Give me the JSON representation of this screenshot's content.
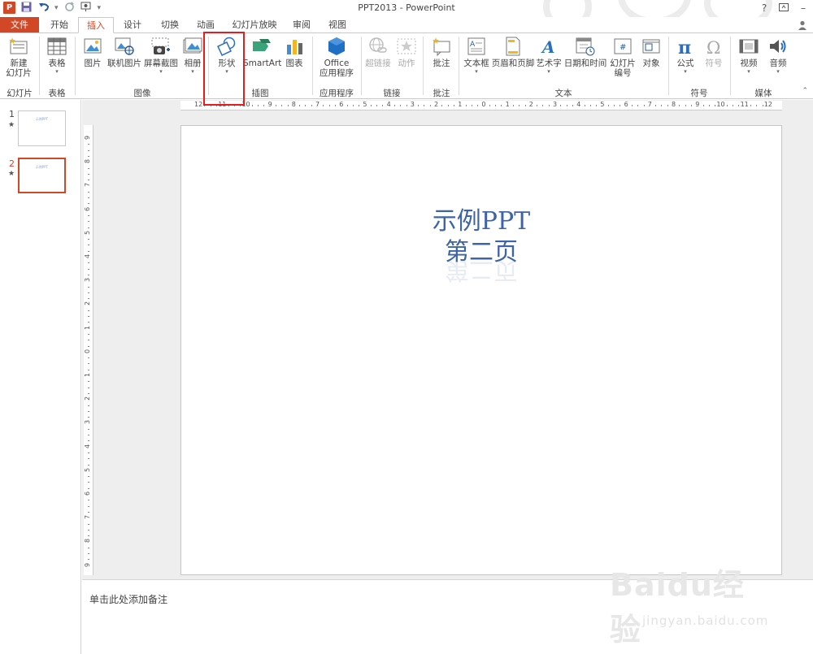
{
  "app": {
    "window_title": "PPT2013 - PowerPoint",
    "logo_letter": "P",
    "help": "?",
    "accent": "#d24726"
  },
  "quick_access": {
    "save_icon": "save-icon",
    "undo_icon": "undo-icon",
    "redo_icon": "redo-icon",
    "start_icon": "slideshow-from-start-icon",
    "customize_icon": "customize-qat-icon"
  },
  "tabs": [
    "文件",
    "开始",
    "插入",
    "设计",
    "切换",
    "动画",
    "幻灯片放映",
    "审阅",
    "视图"
  ],
  "active_tab": "插入",
  "ribbon": {
    "buttons": {
      "new_slide": "新建\n幻灯片",
      "table": "表格",
      "picture": "图片",
      "online_picture": "联机图片",
      "screenshot": "屏幕截图",
      "album": "相册",
      "shapes": "形状",
      "smartart": "SmartArt",
      "chart": "图表",
      "office_apps": "Office\n应用程序",
      "hyperlink": "超链接",
      "action": "动作",
      "comment": "批注",
      "textbox": "文本框",
      "header_footer": "页眉和页脚",
      "wordart": "艺术字",
      "date_time": "日期和时间",
      "slide_number": "幻灯片\n编号",
      "object": "对象",
      "equation": "公式",
      "symbol": "符号",
      "video": "视频",
      "audio": "音频"
    },
    "groups": {
      "slides": "幻灯片",
      "tables": "表格",
      "images": "图像",
      "illustrations": "插图",
      "apps": "应用程序",
      "links": "链接",
      "comments": "批注",
      "text": "文本",
      "symbols": "符号",
      "media": "媒体"
    }
  },
  "thumbnails": [
    {
      "number": "1",
      "star": "★",
      "text": "示例PPT"
    },
    {
      "number": "2",
      "star": "★",
      "text": "示例PPT"
    }
  ],
  "slide": {
    "line1": "示例PPT",
    "line2": "第二页",
    "text_color": "#3e64a8"
  },
  "ruler": {
    "h_labels": [
      "12",
      "11",
      "10",
      "9",
      "8",
      "7",
      "6",
      "5",
      "4",
      "3",
      "2",
      "1",
      "0",
      "1",
      "2",
      "3",
      "4",
      "5",
      "6",
      "7",
      "8",
      "9",
      "10",
      "11",
      "12"
    ],
    "v_labels": [
      "9",
      "8",
      "7",
      "6",
      "5",
      "4",
      "3",
      "2",
      "1",
      "0",
      "1",
      "2",
      "3",
      "4",
      "5",
      "6",
      "7",
      "8",
      "9"
    ]
  },
  "notes": {
    "placeholder": "单击此处添加备注"
  },
  "watermark": {
    "logo": "Baidu经验",
    "url": "jingyan.baidu.com"
  }
}
